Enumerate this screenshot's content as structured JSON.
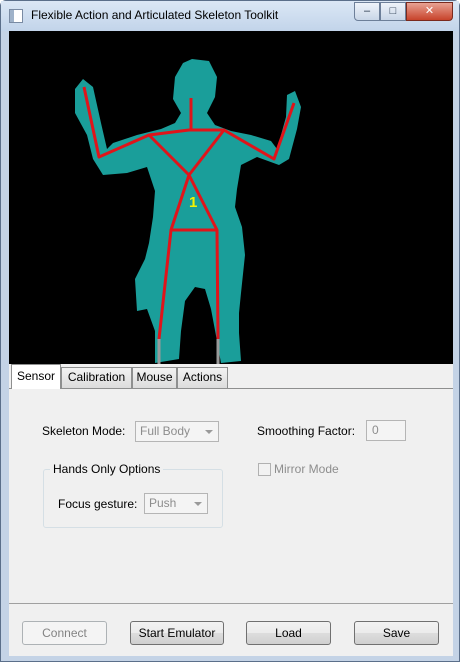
{
  "window": {
    "title": "Flexible Action and Articulated Skeleton Toolkit",
    "minimize_glyph": "–",
    "maximize_glyph": "□",
    "close_glyph": "✕"
  },
  "viewport": {
    "skeleton_id": "1",
    "silhouette_color": "#1a9e9a",
    "bone_color": "#e0141a",
    "label_color": "#f4f400"
  },
  "tabs": [
    {
      "label": "Sensor",
      "active": true
    },
    {
      "label": "Calibration",
      "active": false
    },
    {
      "label": "Mouse",
      "active": false
    },
    {
      "label": "Actions",
      "active": false
    }
  ],
  "sensor": {
    "skeleton_mode_label": "Skeleton Mode:",
    "skeleton_mode_value": "Full Body",
    "smoothing_factor_label": "Smoothing Factor:",
    "smoothing_factor_value": "0",
    "hands_only_title": "Hands Only Options",
    "mirror_mode_label": "Mirror Mode",
    "mirror_mode_checked": false,
    "focus_gesture_label": "Focus gesture:",
    "focus_gesture_value": "Push"
  },
  "buttons": {
    "connect": "Connect",
    "start_emulator": "Start Emulator",
    "load": "Load",
    "save": "Save"
  }
}
